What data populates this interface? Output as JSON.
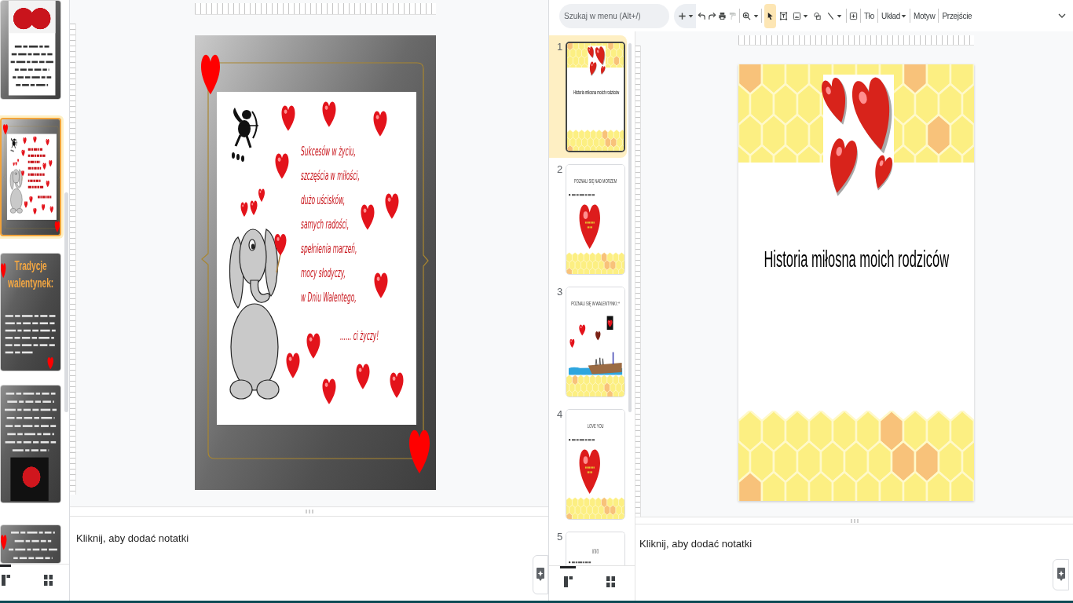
{
  "left_window": {
    "filmstrip": {
      "slides": [
        {
          "kind": "poem_photo",
          "selected": false
        },
        {
          "kind": "greeting",
          "selected": true
        },
        {
          "kind": "title_text",
          "selected": false,
          "title": "Tradycje walentynek:"
        },
        {
          "kind": "text_photo",
          "selected": false
        },
        {
          "kind": "text_heart",
          "selected": false
        }
      ]
    },
    "view_modes": [
      {
        "kind": "filmstrip",
        "selected": true
      },
      {
        "kind": "grid",
        "selected": false
      }
    ],
    "slide": {
      "lines": [
        "Sukcesów w życiu,",
        "szczęścia w miłości,",
        "dużo uścisków,",
        "samych radości,",
        "spełnienia marzeń,",
        "mocy słodyczy,",
        "w Dniu Walentego,"
      ],
      "closing": "...... ci życzy!"
    },
    "notes": {
      "placeholder": "Kliknij, aby dodać notatki"
    }
  },
  "right_window": {
    "toolbar": {
      "search": {
        "placeholder": "Szukaj w menu (Alt+/)"
      },
      "tools": [
        {
          "kind": "select",
          "selected": true
        },
        {
          "kind": "text_box",
          "selected": false
        },
        {
          "kind": "image",
          "selected": false
        },
        {
          "kind": "shape",
          "selected": false
        },
        {
          "kind": "line",
          "selected": false
        }
      ],
      "menus": [
        {
          "label": "Tło",
          "dropdown": false
        },
        {
          "label": "Układ",
          "dropdown": true
        },
        {
          "label": "Motyw",
          "dropdown": false
        },
        {
          "label": "Przejście",
          "dropdown": false
        }
      ]
    },
    "filmstrip": {
      "slides": [
        {
          "number": "1",
          "selected": true,
          "kind": "title",
          "title": "Historia miłosna moich rodziców"
        },
        {
          "number": "2",
          "selected": false,
          "kind": "heart",
          "title": "POZNALI SIĘ NAD MORZEM"
        },
        {
          "number": "3",
          "selected": false,
          "kind": "picture",
          "title": "POZNALI SIĘ W WALENTYNKI :*"
        },
        {
          "number": "4",
          "selected": false,
          "kind": "heart",
          "title": "LOVE YOU"
        },
        {
          "number": "5",
          "selected": false,
          "kind": "text",
          "title": "(((((("
        }
      ]
    },
    "view_modes": [
      {
        "kind": "filmstrip",
        "selected": true
      },
      {
        "kind": "grid",
        "selected": false
      }
    ],
    "slide": {
      "title": "Historia miłosna moich rodziców"
    },
    "notes": {
      "placeholder": "Kliknij, aby dodać notatki"
    }
  }
}
